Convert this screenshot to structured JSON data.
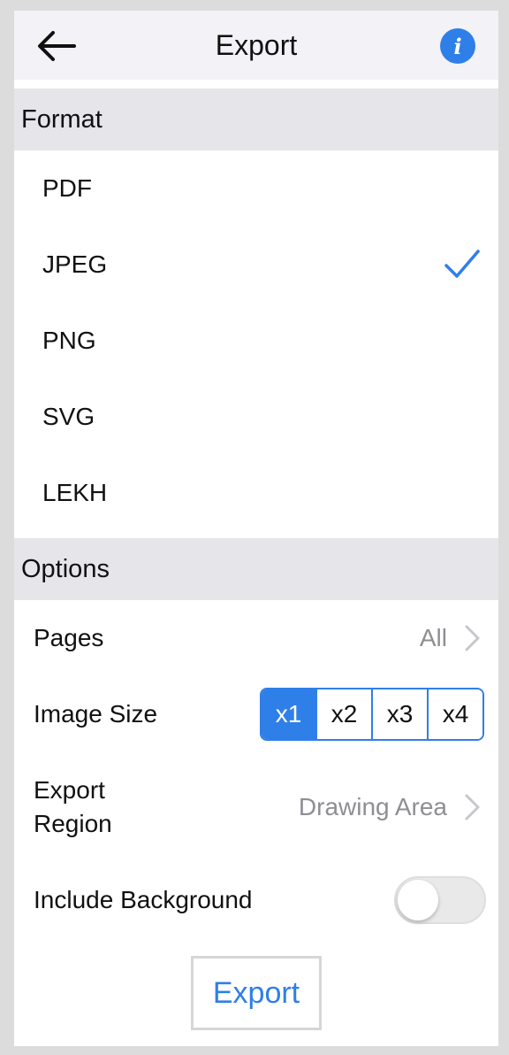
{
  "header": {
    "title": "Export",
    "back_icon": "arrow-left-icon",
    "info_icon": "info-icon",
    "info_glyph": "i"
  },
  "format": {
    "section_label": "Format",
    "items": [
      {
        "label": "PDF",
        "selected": false
      },
      {
        "label": "JPEG",
        "selected": true
      },
      {
        "label": "PNG",
        "selected": false
      },
      {
        "label": "SVG",
        "selected": false
      },
      {
        "label": "LEKH",
        "selected": false
      }
    ]
  },
  "options": {
    "section_label": "Options",
    "pages": {
      "label": "Pages",
      "value": "All"
    },
    "image_size": {
      "label": "Image Size",
      "choices": [
        "x1",
        "x2",
        "x3",
        "x4"
      ],
      "selected": "x1"
    },
    "export_region": {
      "label": "Export\nRegion",
      "value": "Drawing Area"
    },
    "include_background": {
      "label": "Include Background",
      "enabled": false
    }
  },
  "export_button": {
    "label": "Export"
  },
  "colors": {
    "accent": "#2f7fe8",
    "section_bg": "#e5e5ea",
    "header_bg": "#f2f2f7",
    "muted_text": "#8e8e93"
  }
}
